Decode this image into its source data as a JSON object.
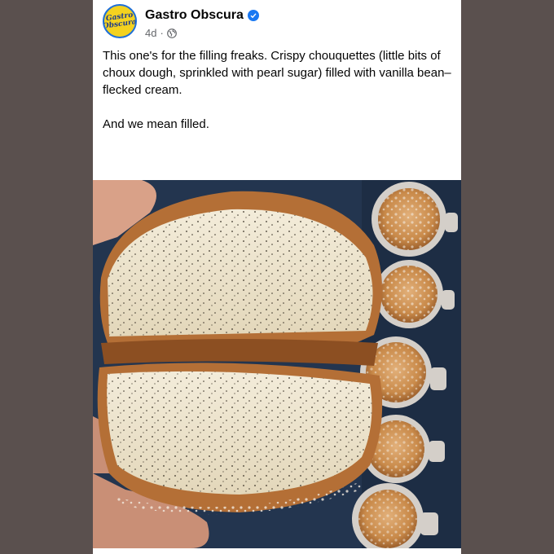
{
  "post": {
    "author": "Gastro Obscura",
    "avatar_text_line1": "Gastro",
    "avatar_text_line2": "Obscura",
    "time": "4d",
    "separator": "·",
    "paragraph1": "This one's for the filling freaks. Crispy chouquettes (little bits of choux dough, sprinkled with pearl sugar) filled with vanilla bean–flecked cream.",
    "paragraph2": "And we mean filled."
  },
  "colors": {
    "background": "#5a504e",
    "card": "#ffffff",
    "verified": "#1877f2",
    "avatar_fill": "#f4d21f",
    "photo_bg": "#23354f"
  },
  "icons": [
    "verified-badge-icon",
    "globe-icon"
  ]
}
